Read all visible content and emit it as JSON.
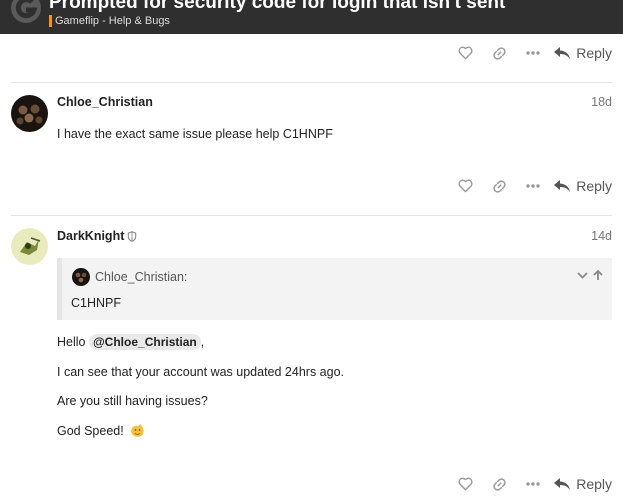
{
  "header": {
    "title": "Prompted for security code for login that isn't sent",
    "category": "Gameflip - Help & Bugs"
  },
  "actions": {
    "like_icon": "heart-icon",
    "link_icon": "link-icon",
    "more_icon": "ellipsis-icon",
    "reply_label": "Reply"
  },
  "posts": [
    {
      "username": "Chloe_Christian",
      "date": "18d",
      "body": "I have the exact same issue please help C1HNPF"
    },
    {
      "username": "DarkKnight",
      "date": "14d",
      "quote": {
        "author": "Chloe_Christian:",
        "text": "C1HNPF"
      },
      "greeting": "Hello",
      "mention": "@Chloe_Christian",
      "greeting_end": ",",
      "lines": [
        "I can see that your account was updated 24hrs ago.",
        "Are you still having issues?",
        "God Speed!"
      ]
    }
  ],
  "colors": {
    "header_bg": "#2f2f2f",
    "brand_orange": "#f7941d",
    "text": "#222222",
    "muted": "#777777"
  }
}
